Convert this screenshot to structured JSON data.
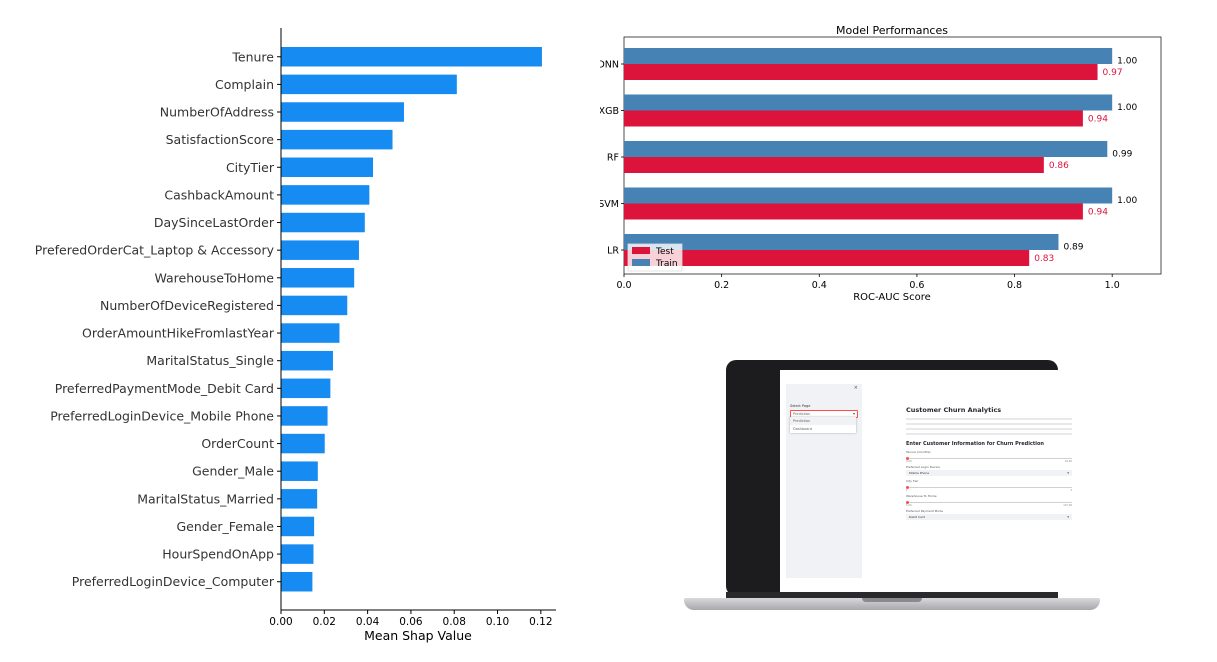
{
  "chart_data": [
    {
      "type": "bar",
      "orientation": "horizontal",
      "categories": [
        "Tenure",
        "Complain",
        "NumberOfAddress",
        "SatisfactionScore",
        "CityTier",
        "CashbackAmount",
        "DaySinceLastOrder",
        "PreferedOrderCat_Laptop & Accessory",
        "WarehouseToHome",
        "NumberOfDeviceRegistered",
        "OrderAmountHikeFromlastYear",
        "MaritalStatus_Single",
        "PreferredPaymentMode_Debit Card",
        "PreferredLoginDevice_Mobile Phone",
        "OrderCount",
        "Gender_Male",
        "MaritalStatus_Married",
        "Gender_Female",
        "HourSpendOnApp",
        "PreferredLoginDevice_Computer"
      ],
      "values": [
        0.1205,
        0.0812,
        0.0568,
        0.0515,
        0.0425,
        0.0408,
        0.0387,
        0.036,
        0.0338,
        0.0306,
        0.027,
        0.024,
        0.0228,
        0.0215,
        0.0202,
        0.017,
        0.0167,
        0.0153,
        0.015,
        0.0145
      ],
      "xlabel": "Mean Shap Value",
      "xlim": [
        0,
        0.127
      ],
      "xticks": [
        "0.00",
        "0.02",
        "0.04",
        "0.06",
        "0.08",
        "0.10",
        "0.12"
      ],
      "color": "#168bf2",
      "grid": false
    },
    {
      "type": "bar",
      "orientation": "horizontal",
      "title": "Model Performances",
      "categories": [
        "DNN",
        "XGB",
        "RF",
        "SVM",
        "LR"
      ],
      "series": [
        {
          "name": "Train",
          "color": "#4682b4",
          "values": [
            1.0,
            1.0,
            0.99,
            1.0,
            0.89
          ],
          "labels": [
            "1.00",
            "1.00",
            "0.99",
            "1.00",
            "0.89"
          ]
        },
        {
          "name": "Test",
          "color": "#dc143c",
          "values": [
            0.97,
            0.94,
            0.86,
            0.94,
            0.83
          ],
          "labels": [
            "0.97",
            "0.94",
            "0.86",
            "0.94",
            "0.83"
          ]
        }
      ],
      "legend": {
        "items": [
          "Test",
          "Train"
        ],
        "position": "lower-left"
      },
      "xlabel": "ROC-AUC Score",
      "xlim": [
        0,
        1.1
      ],
      "xticks": [
        "0.0",
        "0.2",
        "0.4",
        "0.6",
        "0.8",
        "1.0"
      ],
      "grid": false
    }
  ],
  "laptop_app": {
    "sidebar": {
      "close": "×",
      "label": "Select Page",
      "selected": "Prediction",
      "options": [
        "Prediction",
        "Dashboard"
      ]
    },
    "main": {
      "title": "Customer Churn Analytics",
      "form_heading": "Enter Customer Information for Churn Prediction",
      "fields": [
        {
          "label": "Tenure (months)",
          "kind": "slider",
          "min": "0.00",
          "max": "61.00"
        },
        {
          "label": "Preferred Login Device",
          "kind": "select",
          "value": "Mobile Phone"
        },
        {
          "label": "City Tier",
          "kind": "number",
          "min": "1",
          "max": "3"
        },
        {
          "label": "Warehouse To Home",
          "kind": "slider",
          "min": "5.00",
          "max": "127.00"
        },
        {
          "label": "Preferred Payment Mode",
          "kind": "select",
          "value": "Debit Card"
        }
      ]
    }
  }
}
